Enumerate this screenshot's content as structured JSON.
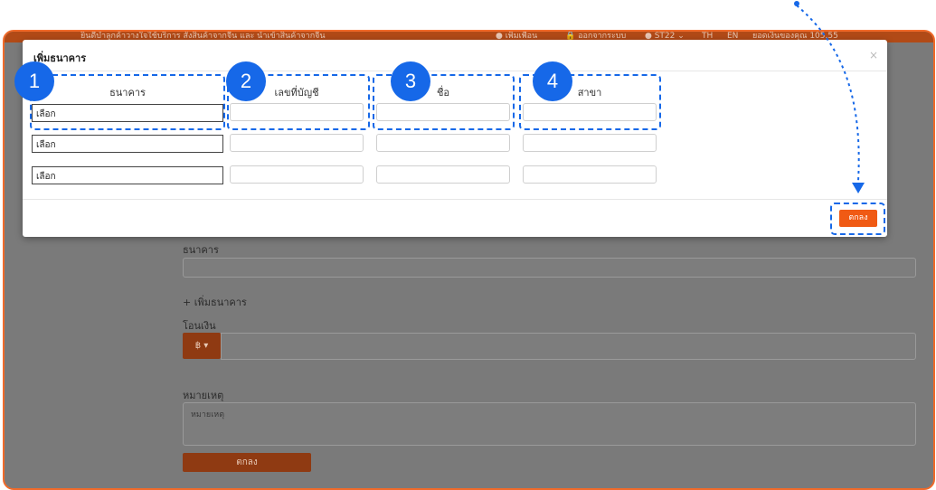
{
  "topbar": {
    "marquee": "ยินดีบำลูกค้าวางใจใช้บริการ สั่งสินค้าจากจีน และ นำเข้าสินค้าจากจีน",
    "add_friend": "เพิ่มเพื่อน",
    "logout": "ออกจากระบบ",
    "user": "ST22",
    "lang_th": "TH",
    "lang_en": "EN",
    "balance": "ยอดเงินของคุณ 105.55"
  },
  "background_form": {
    "bank_label": "ธนาคาร",
    "add_bank_link": "+ เพิ่มธนาคาร",
    "transfer_label": "โอนเงิน",
    "currency_symbol": "฿",
    "note_label": "หมายเหตุ",
    "note_placeholder": "หมายเหตุ",
    "submit_label": "ตกลง"
  },
  "modal": {
    "title": "เพิ่มธนาคาร",
    "close": "×",
    "columns": [
      "ธนาคาร",
      "เลขที่บัญชี",
      "ชื่อ",
      "สาขา"
    ],
    "rows": [
      {
        "bank": "เลือก",
        "account": "",
        "name": "",
        "branch": ""
      },
      {
        "bank": "เลือก",
        "account": "",
        "name": "",
        "branch": ""
      },
      {
        "bank": "เลือก",
        "account": "",
        "name": "",
        "branch": ""
      }
    ],
    "ok_label": "ตกลง"
  },
  "annotations": {
    "badges": [
      "1",
      "2",
      "3",
      "4"
    ],
    "accent_color": "#1668e8",
    "brand_color": "#f05a14"
  }
}
